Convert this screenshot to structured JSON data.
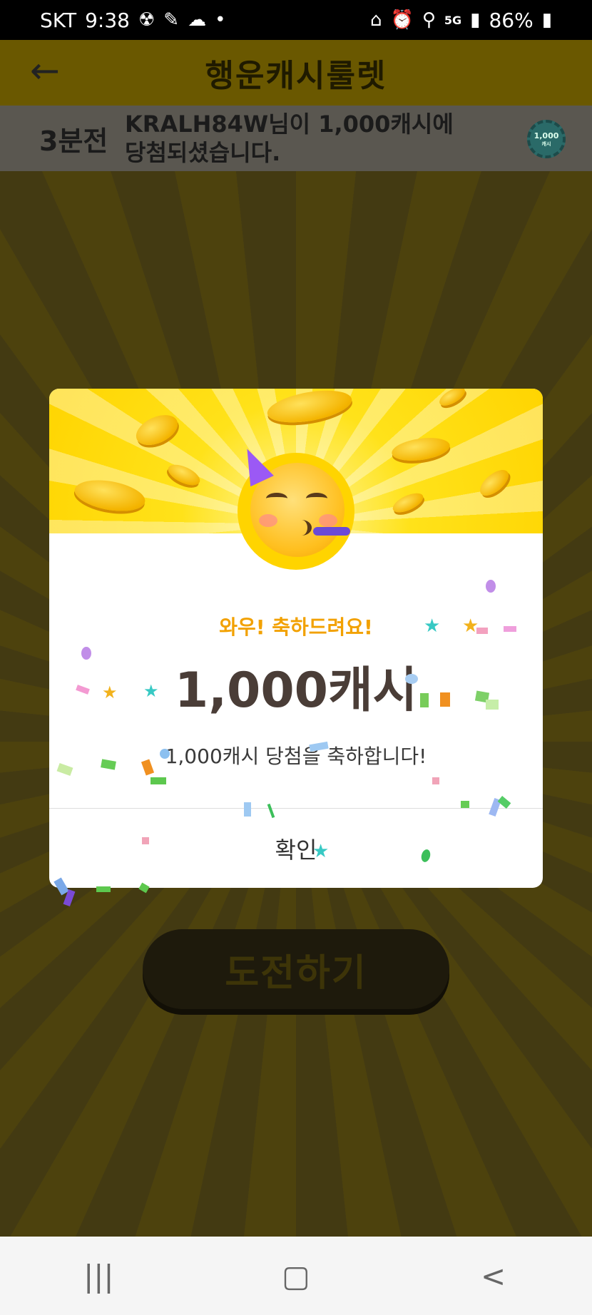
{
  "status_bar": {
    "carrier": "SKT",
    "time": "9:38",
    "network": "5G",
    "battery": "86%"
  },
  "app_bar": {
    "title": "행운캐시룰렛"
  },
  "ticker": {
    "time_ago": "3분전",
    "message": "KRALH84W님이 1,000캐시에 당첨되셨습니다.",
    "badge_amount": "1,000",
    "badge_unit": "캐시"
  },
  "challenge_button": {
    "label": "도전하기"
  },
  "dialog": {
    "wow_text": "와우! 축하드려요!",
    "amount_text": "1,000캐시",
    "congrats_text": "1,000캐시 당첨을 축하합니다!",
    "confirm_label": "확인"
  },
  "nav": {
    "recents_icon": "recents-icon",
    "home_icon": "home-icon",
    "back_icon": "back-icon"
  },
  "colors": {
    "accent_yellow": "#ffd400",
    "wow_orange": "#f2a100",
    "amount_text": "#4a3d37"
  }
}
